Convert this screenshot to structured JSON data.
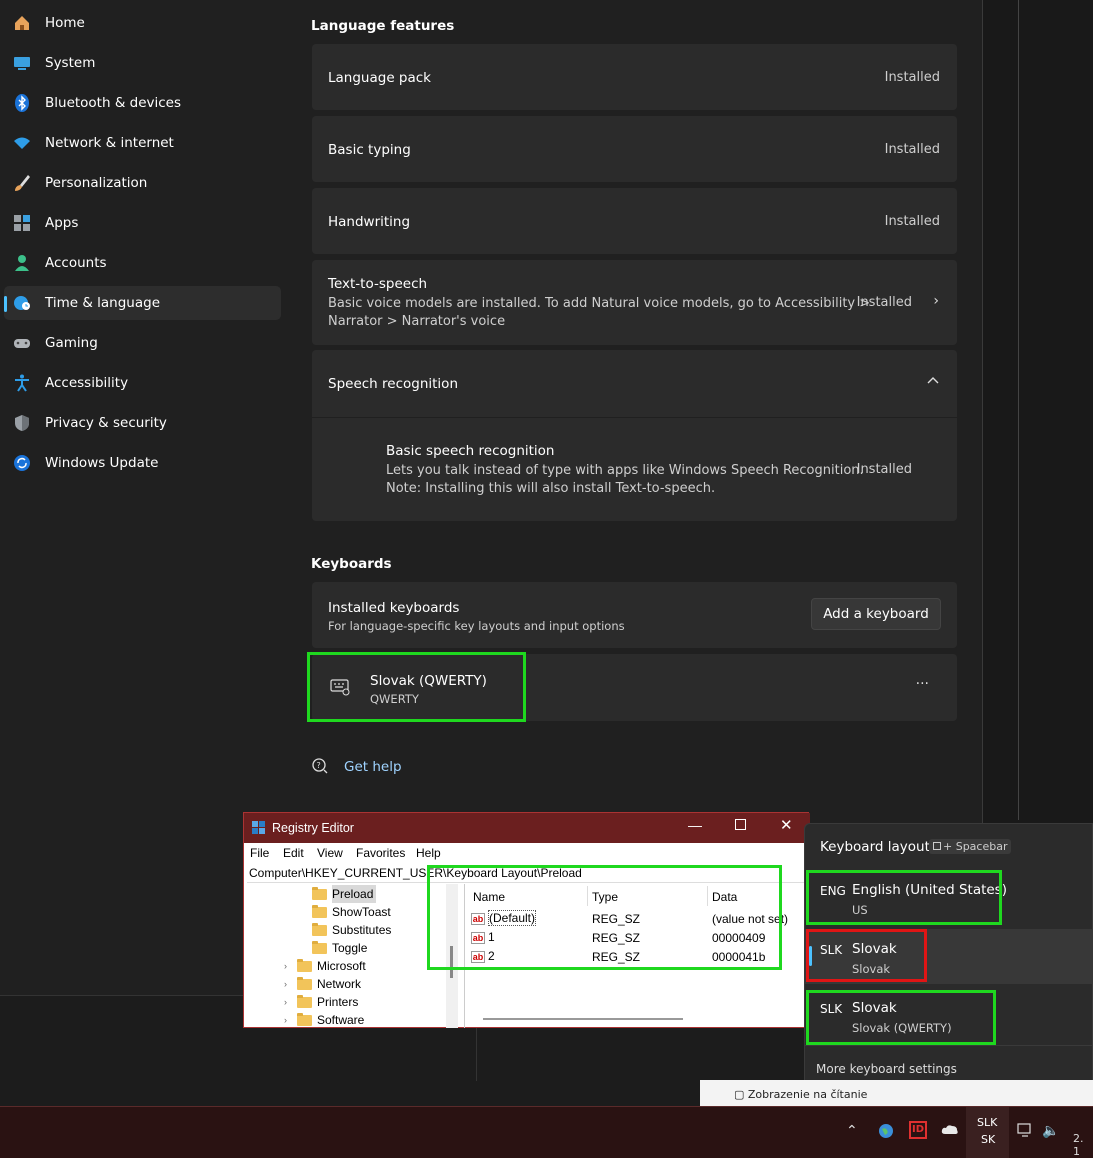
{
  "sidebar": {
    "items": [
      {
        "label": "Home",
        "icon": "home-icon"
      },
      {
        "label": "System",
        "icon": "monitor-icon"
      },
      {
        "label": "Bluetooth & devices",
        "icon": "bluetooth-icon"
      },
      {
        "label": "Network & internet",
        "icon": "wifi-icon"
      },
      {
        "label": "Personalization",
        "icon": "brush-icon"
      },
      {
        "label": "Apps",
        "icon": "apps-icon"
      },
      {
        "label": "Accounts",
        "icon": "person-icon"
      },
      {
        "label": "Time & language",
        "icon": "globe-clock-icon",
        "active": true
      },
      {
        "label": "Gaming",
        "icon": "gamepad-icon"
      },
      {
        "label": "Accessibility",
        "icon": "accessibility-icon"
      },
      {
        "label": "Privacy & security",
        "icon": "shield-icon"
      },
      {
        "label": "Windows Update",
        "icon": "update-icon"
      }
    ]
  },
  "language_features": {
    "title": "Language features",
    "items": [
      {
        "title": "Language pack",
        "status": "Installed"
      },
      {
        "title": "Basic typing",
        "status": "Installed"
      },
      {
        "title": "Handwriting",
        "status": "Installed"
      },
      {
        "title": "Text-to-speech",
        "subtitle_line1": "Basic voice models are installed. To add Natural voice models, go to Accessibility >",
        "subtitle_line2": "Narrator > Narrator's voice",
        "status": "Installed"
      },
      {
        "title": "Speech recognition"
      }
    ],
    "speech_sub": {
      "title": "Basic speech recognition",
      "line1": "Lets you talk instead of type with apps like Windows Speech Recognition.",
      "line2": "Note: Installing this will also install Text-to-speech.",
      "status": "Installed"
    }
  },
  "keyboards": {
    "title": "Keyboards",
    "installed_title": "Installed keyboards",
    "installed_sub": "For language-specific key layouts and input options",
    "add_button": "Add a keyboard",
    "keyboard_name": "Slovak (QWERTY)",
    "keyboard_sub": "QWERTY",
    "more": "···"
  },
  "help": {
    "label": "Get help"
  },
  "registry": {
    "title": "Registry Editor",
    "menu": [
      "File",
      "Edit",
      "View",
      "Favorites",
      "Help"
    ],
    "address": "Computer\\HKEY_CURRENT_USER\\Keyboard Layout\\Preload",
    "tree": [
      "Preload",
      "ShowToast",
      "Substitutes",
      "Toggle",
      "Microsoft",
      "Network",
      "Printers",
      "Software"
    ],
    "columns": [
      "Name",
      "Type",
      "Data"
    ],
    "rows": [
      {
        "name": "(Default)",
        "type": "REG_SZ",
        "data": "(value not set)"
      },
      {
        "name": "1",
        "type": "REG_SZ",
        "data": "00000409"
      },
      {
        "name": "2",
        "type": "REG_SZ",
        "data": "0000041b"
      }
    ]
  },
  "flyout": {
    "title": "Keyboard layout",
    "hint": "+ Spacebar",
    "items": [
      {
        "code": "ENG",
        "name": "English (United States)",
        "sub": "US"
      },
      {
        "code": "SLK",
        "name": "Slovak",
        "sub": "Slovak",
        "selected": true
      },
      {
        "code": "SLK",
        "name": "Slovak",
        "sub": "Slovak (QWERTY)"
      }
    ],
    "more": "More keyboard settings"
  },
  "taskbar": {
    "lang_line1": "SLK",
    "lang_line2": "SK",
    "clock": "2. 1",
    "reading_view": "Zobrazenie na čítanie"
  },
  "colors": {
    "accent": "#4cc2ff",
    "highlight_green": "#1fd81f",
    "highlight_red": "#e01515"
  }
}
